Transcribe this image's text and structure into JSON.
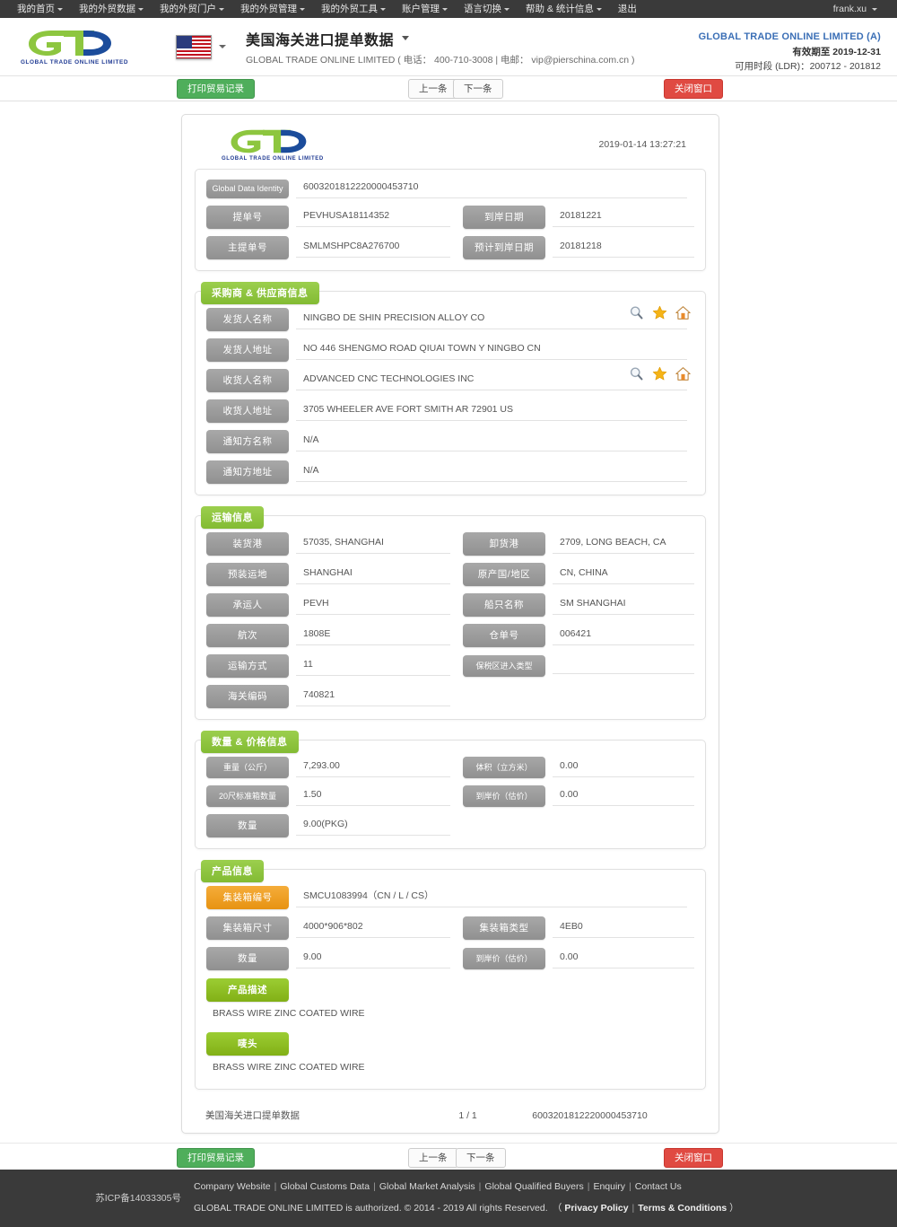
{
  "topnav": {
    "items": [
      {
        "label": "我的首页",
        "caret": true
      },
      {
        "label": "我的外贸数据",
        "caret": true
      },
      {
        "label": "我的外贸门户",
        "caret": true
      },
      {
        "label": "我的外贸管理",
        "caret": true
      },
      {
        "label": "我的外贸工具",
        "caret": true
      },
      {
        "label": "账户管理",
        "caret": true
      },
      {
        "label": "语言切换",
        "caret": true
      },
      {
        "label": "帮助 & 统计信息",
        "caret": true
      },
      {
        "label": "退出",
        "caret": false
      }
    ],
    "user": "frank.xu"
  },
  "header": {
    "logo_text": "GLOBAL TRADE ONLINE LIMITED",
    "flag": "us-flag-icon",
    "title": "美国海关进口提单数据",
    "subtitle": "GLOBAL TRADE ONLINE LIMITED ( 电话： 400-710-3008 | 电邮： vip@pierschina.com.cn )",
    "account_name": "GLOBAL TRADE ONLINE LIMITED (A)",
    "valid_until": "有效期至 2019-12-31",
    "ldr": "可用时段 (LDR)：200712 - 201812",
    "accent_blue": "#3b6fb6"
  },
  "actionbar": {
    "print": "打印贸易记录",
    "prev": "上一条",
    "next": "下一条",
    "close": "关闭窗口",
    "green": "#4fae5b",
    "red": "#e04a42"
  },
  "document": {
    "timestamp": "2019-01-14 13:27:21",
    "identity_section": {
      "rows": [
        {
          "label": "Global Data Identity",
          "value": "6003201812220000453710",
          "full": true,
          "wide": true
        },
        {
          "label": "提单号",
          "value": "PEVHUSA18114352",
          "label2": "到岸日期",
          "value2": "20181221"
        },
        {
          "label": "主提单号",
          "value": "SMLMSHPC8A276700",
          "label2": "预计到岸日期",
          "value2": "20181218"
        }
      ]
    },
    "sections": [
      {
        "title": "采购商 & 供应商信息",
        "rows": [
          {
            "label": "发货人名称",
            "value": "NINGBO DE SHIN PRECISION ALLOY CO",
            "full": true,
            "icons": true
          },
          {
            "label": "发货人地址",
            "value": "NO 446 SHENGMO ROAD QIUAI TOWN Y NINGBO CN",
            "full": true
          },
          {
            "label": "收货人名称",
            "value": "ADVANCED CNC TECHNOLOGIES INC",
            "full": true,
            "icons": true
          },
          {
            "label": "收货人地址",
            "value": "3705 WHEELER AVE FORT SMITH AR 72901 US",
            "full": true
          },
          {
            "label": "通知方名称",
            "value": "N/A",
            "full": true
          },
          {
            "label": "通知方地址",
            "value": "N/A",
            "full": true
          }
        ]
      },
      {
        "title": "运输信息",
        "rows": [
          {
            "label": "装货港",
            "value": "57035, SHANGHAI",
            "label2": "卸货港",
            "value2": "2709, LONG BEACH, CA"
          },
          {
            "label": "预装运地",
            "value": "SHANGHAI",
            "label2": "原产国/地区",
            "value2": "CN, CHINA"
          },
          {
            "label": "承运人",
            "value": "PEVH",
            "label2": "船只名称",
            "value2": "SM SHANGHAI"
          },
          {
            "label": "航次",
            "value": "1808E",
            "label2": "仓单号",
            "value2": "006421"
          },
          {
            "label": "运输方式",
            "value": "11",
            "label2": "保税区进入类型",
            "value2": "",
            "wide2": true
          },
          {
            "label": "海关编码",
            "value": "740821",
            "label2": "",
            "value2": "",
            "hide2": true
          }
        ]
      },
      {
        "title": "数量 & 价格信息",
        "rows": [
          {
            "label": "重量（公斤）",
            "value": "7,293.00",
            "label2": "体积（立方米）",
            "value2": "0.00",
            "wide": true,
            "wide2": true
          },
          {
            "label": "20尺标准箱数量",
            "value": "1.50",
            "label2": "到岸价（估价）",
            "value2": "0.00",
            "wide": true,
            "wide2": true
          },
          {
            "label": "数量",
            "value": "9.00(PKG)",
            "label2": "",
            "value2": "",
            "hide2": true
          }
        ]
      },
      {
        "title": "产品信息",
        "rows": [
          {
            "label": "集装箱编号",
            "value": "SMCU1083994（CN / L / CS）",
            "full": true,
            "orange": true
          },
          {
            "label": "集装箱尺寸",
            "value": "4000*906*802",
            "label2": "集装箱类型",
            "value2": "4EB0"
          },
          {
            "label": "数量",
            "value": "9.00",
            "label2": "到岸价（估价）",
            "value2": "0.00",
            "wide2": true
          }
        ],
        "blocks": [
          {
            "label": "产品描述",
            "text": "BRASS WIRE ZINC COATED WIRE"
          },
          {
            "label": "唛头",
            "text": "BRASS WIRE ZINC COATED WIRE"
          }
        ]
      }
    ],
    "footer": {
      "left": "美国海关进口提单数据",
      "middle": "1 / 1",
      "right": "6003201812220000453710"
    }
  },
  "pagefooter": {
    "icp": "苏ICP备14033305号",
    "links": [
      "Company Website",
      "Global Customs Data",
      "Global Market Analysis",
      "Global Qualified Buyers",
      "Enquiry",
      "Contact Us"
    ],
    "copy_prefix": "GLOBAL TRADE ONLINE LIMITED is authorized. © 2014 - 2019 All rights Reserved.　（ ",
    "privacy": "Privacy Policy",
    "terms": "Terms & Conditions",
    "copy_suffix": " ）"
  }
}
